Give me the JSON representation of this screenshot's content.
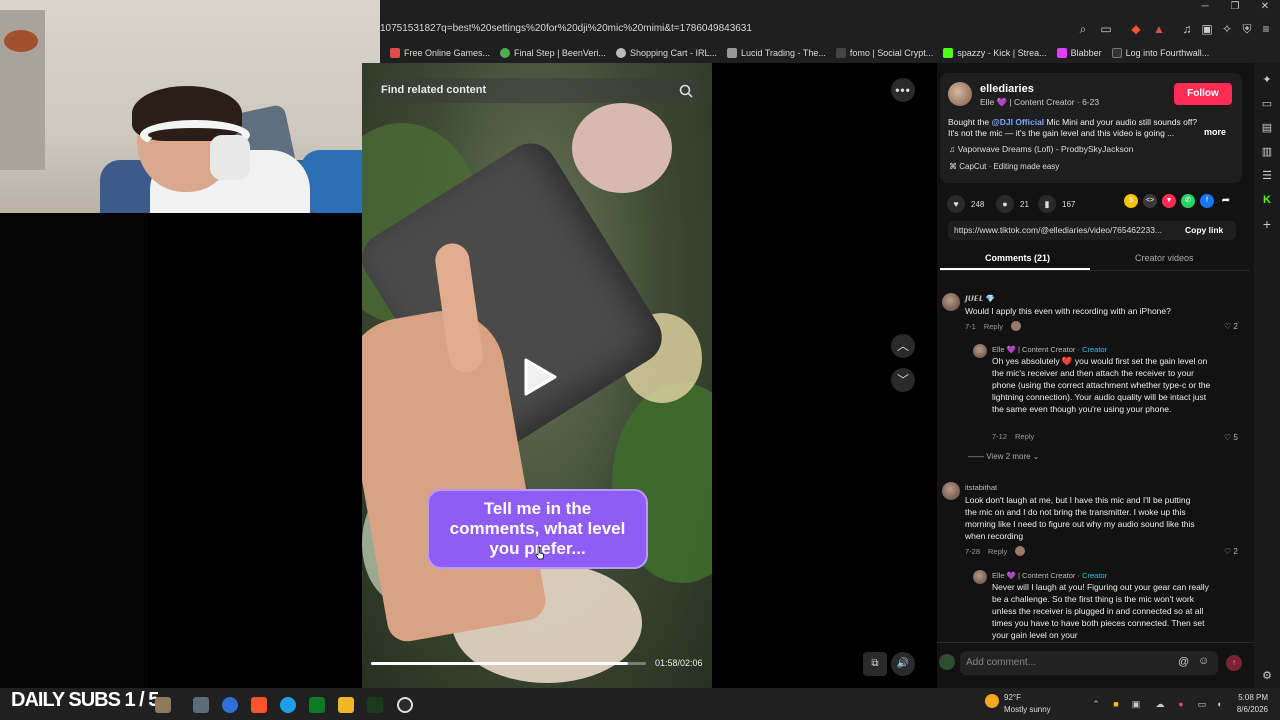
{
  "browser": {
    "url": "10751531827q=best%20settings%20for%20dji%20mic%20mimi&t=1786049843631",
    "bookmarks": [
      {
        "label": "Free Online Games...",
        "color": "#e34b4b"
      },
      {
        "label": "Final Step | BeenVeri...",
        "color": "#4caf50"
      },
      {
        "label": "Shopping Cart - IRL...",
        "color": "#bbbbbb"
      },
      {
        "label": "Lucid Trading - The...",
        "color": "#999999"
      },
      {
        "label": "fomo | Social Crypt...",
        "color": "#444444"
      },
      {
        "label": "spazzy - Kick | Strea...",
        "color": "#53fc18"
      },
      {
        "label": "Blabber",
        "color": "#e040fb"
      },
      {
        "label": "Log into Fourthwall...",
        "color": "#333333"
      }
    ],
    "window_buttons": [
      "─",
      "❐",
      "✕"
    ]
  },
  "video": {
    "search_placeholder": "Find related content",
    "caption": "Tell me in the comments, what level you prefer...",
    "time": "01:58/02:06",
    "progress_fraction": 0.936
  },
  "author": {
    "username": "ellediaries",
    "subline": "Elle 💜 | Content Creator · 6-23",
    "follow_label": "Follow",
    "desc_prefix": "Bought the ",
    "desc_mention": "@DJI Official",
    "desc_suffix": " Mic Mini and your audio still sounds off? It's not the mic — it's the gain level and this video is going ...",
    "more_label": "more",
    "music": "Vaporwave Dreams (Lofi) - ProdbySkyJackson",
    "capcut": "CapCut · Editing made easy"
  },
  "stats": {
    "likes": "248",
    "comments": "21",
    "saves": "167"
  },
  "share": {
    "link": "https://www.tiktok.com/@ellediaries/video/765462233...",
    "copy_label": "Copy link",
    "icons": [
      {
        "name": "coin-icon",
        "color": "#f4c20d"
      },
      {
        "name": "embed-icon",
        "color": "#3a3a3a"
      },
      {
        "name": "send-icon",
        "color": "#fe2c55"
      },
      {
        "name": "whatsapp-icon",
        "color": "#25d366"
      },
      {
        "name": "facebook-icon",
        "color": "#1877f2"
      }
    ]
  },
  "tabs": {
    "comments": "Comments (21)",
    "creator": "Creator videos"
  },
  "comments": [
    {
      "name": "𝙅𝙐𝙀𝙇 💎",
      "text": "Would I apply this even with recording with an iPhone?",
      "date": "7-1",
      "reply": "Reply",
      "likes": "2"
    },
    {
      "name": "Elle 💜 | Content Creator · ",
      "tag": "Creator",
      "text": "Oh yes absolutely ❤️ you would first set the gain level on the mic's receiver and then attach the receiver to your phone (using the correct attachment whether type-c or the lightning connection). Your audio quality will be intact just the same even though you're using your phone.",
      "date": "7-12",
      "reply": "Reply",
      "likes": "5"
    },
    {
      "name": "itstabithat",
      "text": "Look don't laugh at me, but I have this mic and I'll be putting the mic on and I do not bring the transmitter. I woke up this morning like I need to figure out why my audio sound like this when recording",
      "date": "7-28",
      "reply": "Reply",
      "likes": "2"
    },
    {
      "name": "Elle 💜 | Content Creator · ",
      "tag": "Creator",
      "text": "Never will I laugh at you! Figuring out your gear can really be a challenge. So the first thing is the mic won't work unless the receiver is plugged in and connected so at all times you have to have both pieces connected. Then set your gain level on your"
    }
  ],
  "view_more": "View 2 more",
  "add_comment_placeholder": "Add comment...",
  "taskbar": {
    "overlay_text": "DAILY SUBS 1 / 5",
    "weather_temp": "92°F",
    "weather_desc": "Mostly sunny",
    "time": "5:08 PM",
    "date": "8/6/2026"
  }
}
